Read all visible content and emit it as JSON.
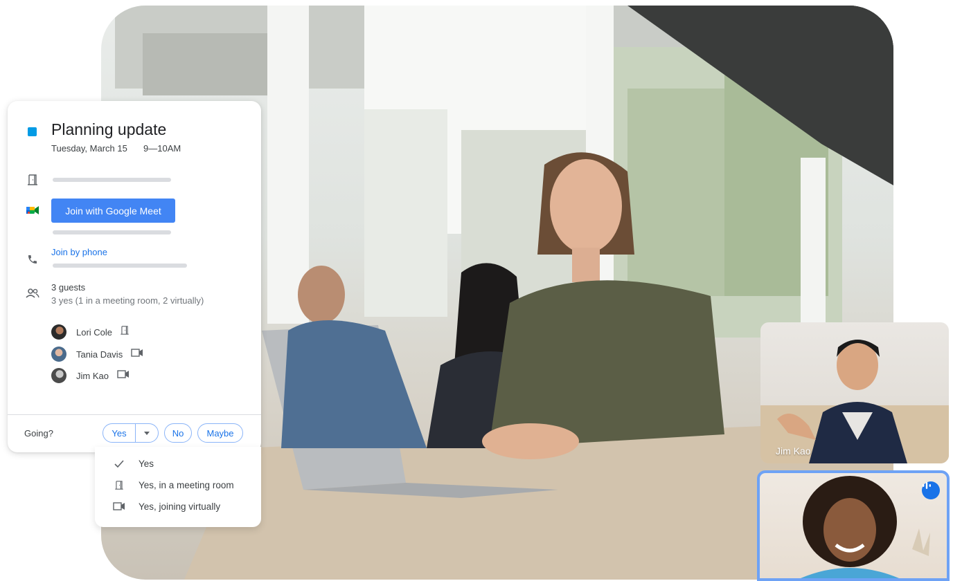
{
  "event": {
    "title": "Planning update",
    "date": "Tuesday, March 15",
    "time": "9—10AM",
    "color": "#039be5",
    "join_meet_label": "Join with Google Meet",
    "join_phone_label": "Join by phone",
    "guests_count": "3 guests",
    "guests_summary": "3 yes (1 in a meeting room, 2 virtually)",
    "guests": [
      {
        "name": "Lori Cole",
        "icon": "meeting-room-icon"
      },
      {
        "name": "Tania Davis",
        "icon": "video-camera-icon"
      },
      {
        "name": "Jim Kao",
        "icon": "video-camera-icon"
      }
    ]
  },
  "rsvp": {
    "prompt": "Going?",
    "yes": "Yes",
    "no": "No",
    "maybe": "Maybe",
    "menu": [
      {
        "label": "Yes",
        "icon": "check-icon"
      },
      {
        "label": "Yes, in a meeting room",
        "icon": "meeting-room-icon"
      },
      {
        "label": "Yes, joining virtually",
        "icon": "video-camera-icon"
      }
    ]
  },
  "video": {
    "tile_1_name": "Jim Kao",
    "speaking_icon": "audio-level-icon"
  },
  "colors": {
    "accent": "#1a73e8",
    "button": "#4285f4",
    "active_tile_border": "#6ea2f5"
  }
}
